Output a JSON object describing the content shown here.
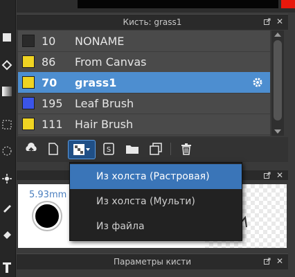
{
  "brush_panel": {
    "title": "Кисть: grass1",
    "brushes": [
      {
        "num": "10",
        "name": "NONAME",
        "color": "#2a2a2a"
      },
      {
        "num": "86",
        "name": "From Canvas",
        "color": "#f0d422"
      },
      {
        "num": "70",
        "name": "grass1",
        "color": "#f0d422",
        "selected": true
      },
      {
        "num": "195",
        "name": "Leaf Brush",
        "color": "#3b55e8"
      },
      {
        "num": "111",
        "name": "Hair Brush",
        "color": "#f0d422"
      }
    ]
  },
  "toolbar": {
    "buttons": [
      "upload-icon",
      "new-page-icon",
      "from-canvas-icon",
      "script-icon",
      "folder-icon",
      "duplicate-icon",
      "delete-icon"
    ]
  },
  "preview": {
    "size_label": "5.93mm"
  },
  "menu": {
    "items": [
      "Из холста (Растровая)",
      "Из холста (Мульти)",
      "Из файла"
    ]
  },
  "bottom_panel": {
    "title": "Параметры кисти"
  },
  "colors": {
    "accent": "#4d8ed0",
    "red": "#e8180c"
  }
}
